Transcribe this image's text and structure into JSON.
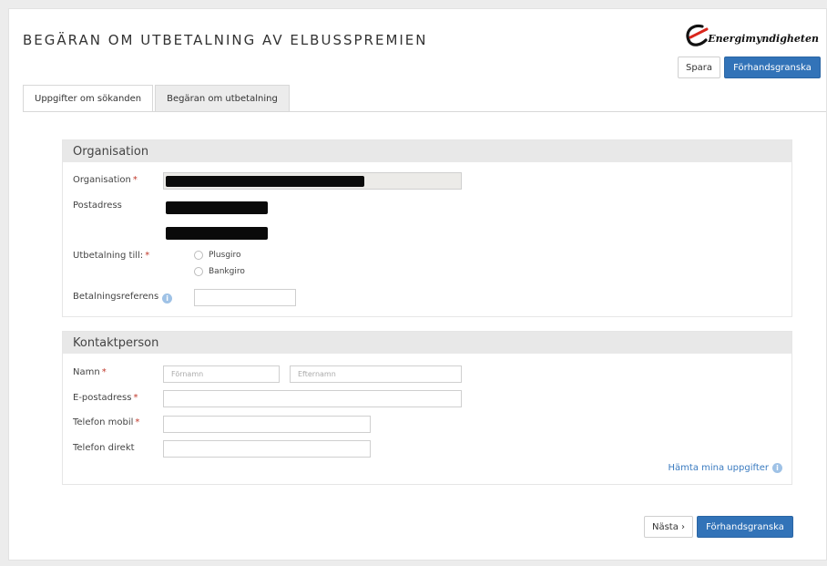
{
  "header": {
    "title": "BEGÄRAN OM UTBETALNING AV ELBUSSPREMIEN",
    "logo_text": "Energimyndigheten"
  },
  "toolbar": {
    "save_label": "Spara",
    "preview_label": "Förhandsgranska"
  },
  "tabs": [
    {
      "label": "Uppgifter om sökanden",
      "active": true
    },
    {
      "label": "Begäran om utbetalning",
      "active": false
    }
  ],
  "organisation": {
    "heading": "Organisation",
    "org_label": "Organisation",
    "postal_label": "Postadress",
    "payout_label": "Utbetalning till:",
    "payout_options": [
      "Plusgiro",
      "Bankgiro"
    ],
    "ref_label": "Betalningsreferens"
  },
  "contact": {
    "heading": "Kontaktperson",
    "name_label": "Namn",
    "first_placeholder": "Förnamn",
    "last_placeholder": "Efternamn",
    "email_label": "E-postadress",
    "mobile_label": "Telefon mobil",
    "direct_label": "Telefon direkt",
    "fetch_link": "Hämta mina uppgifter"
  },
  "footer": {
    "next_label": "Nästa ›",
    "preview_label": "Förhandsgranska"
  },
  "required_mark": "*",
  "info_glyph": "i",
  "colors": {
    "primary": "#3273b8",
    "required": "#c0392b",
    "link": "#3a7bc0",
    "logo_red": "#d9261c"
  }
}
